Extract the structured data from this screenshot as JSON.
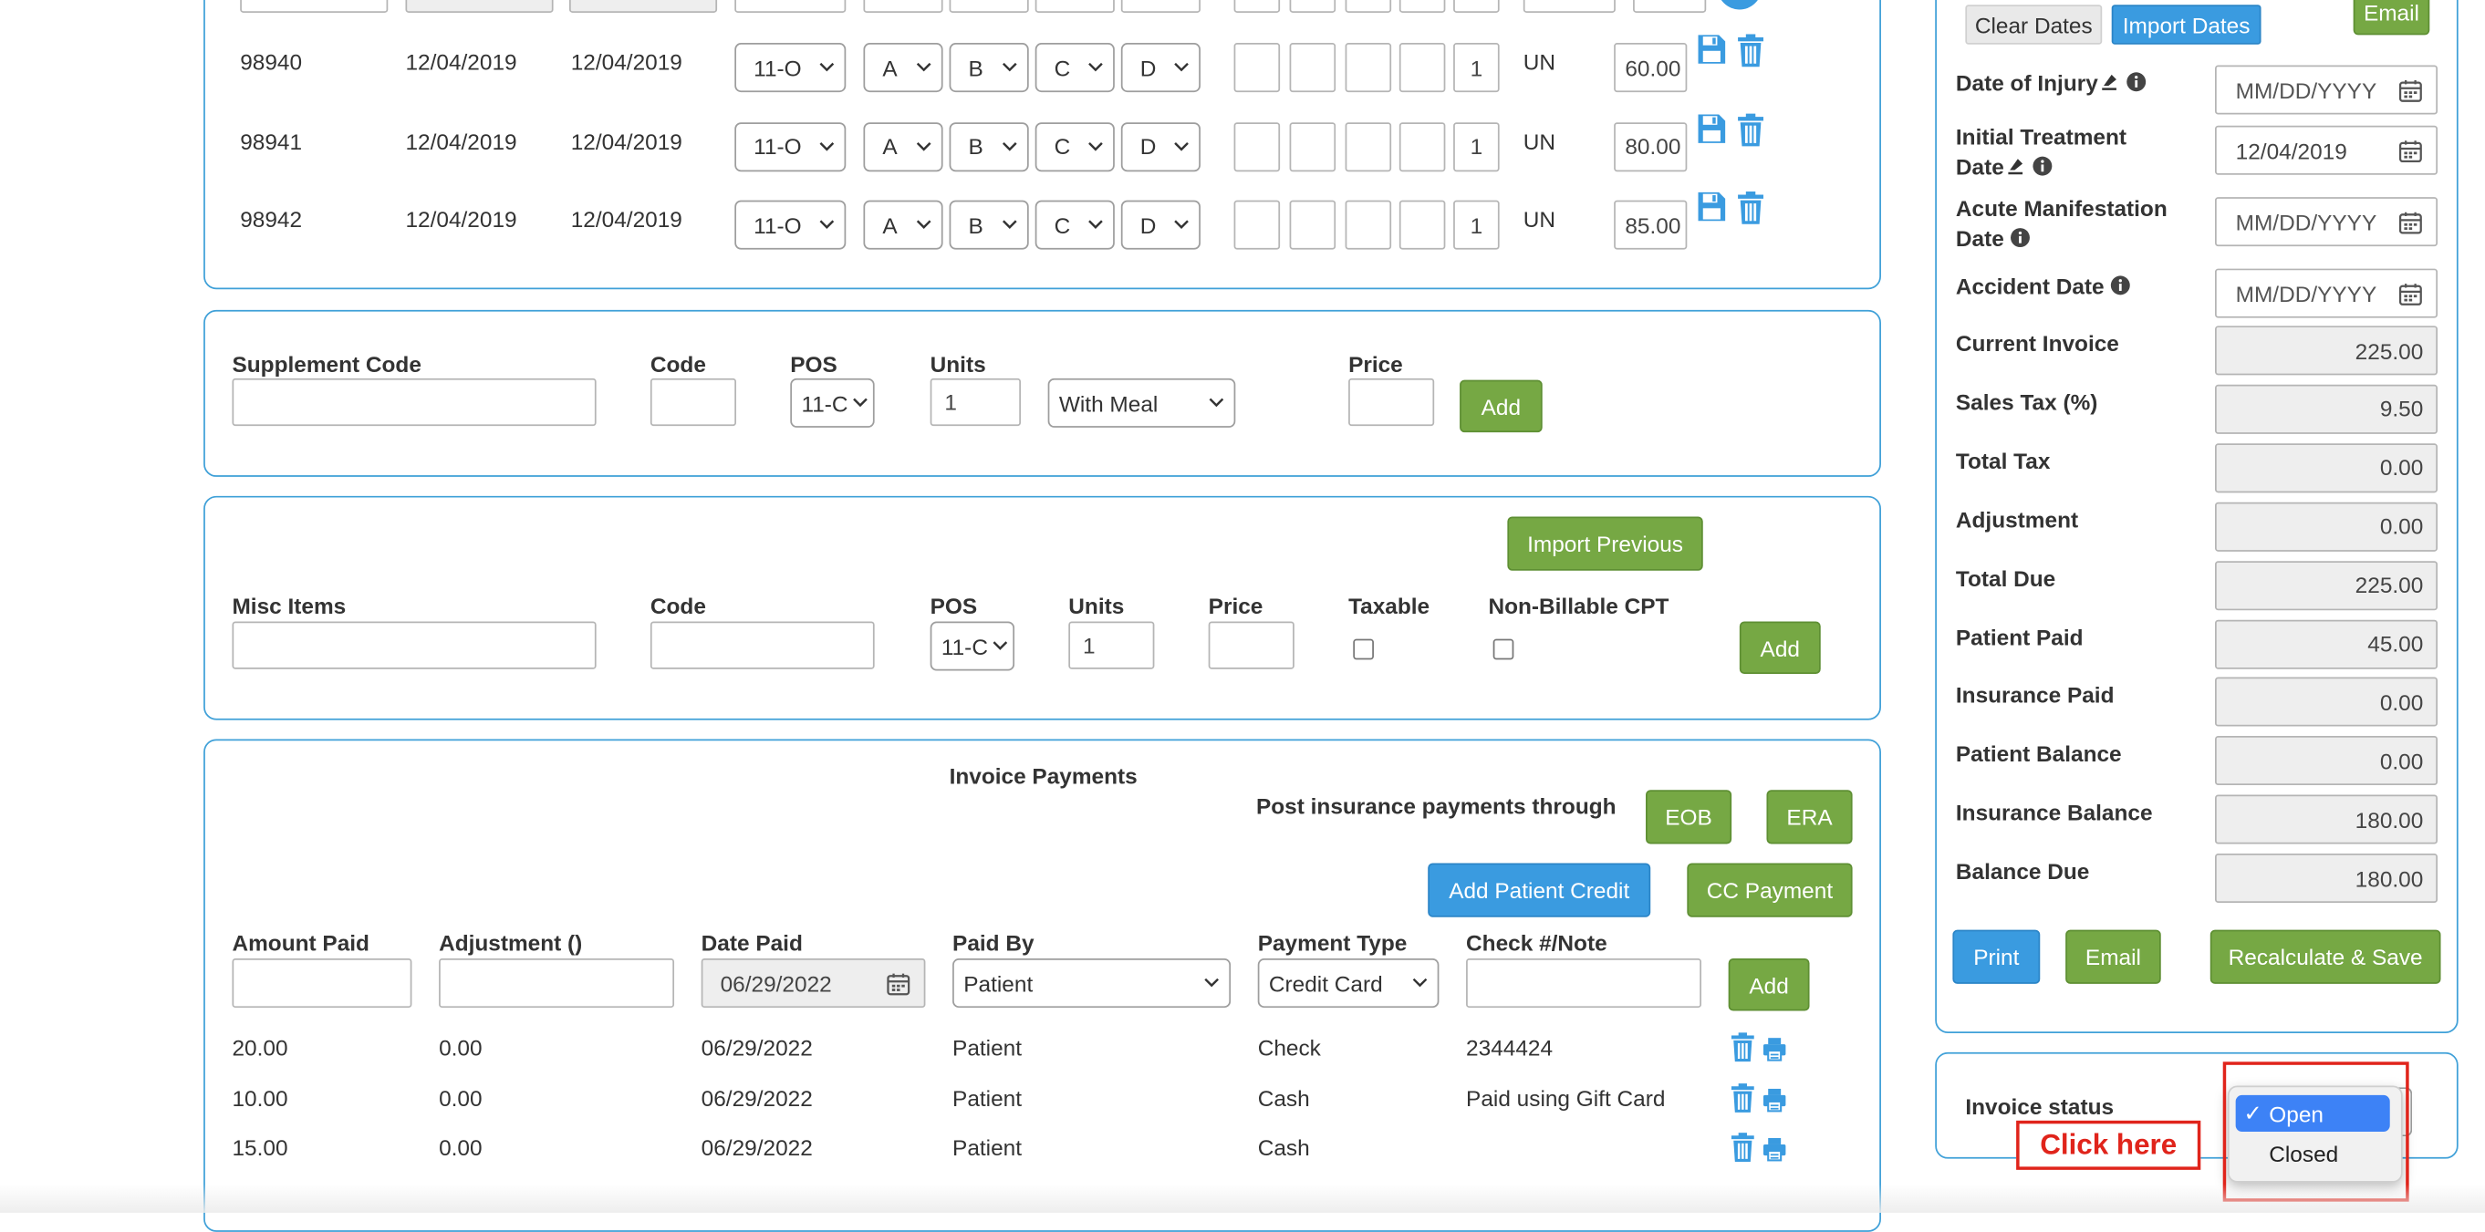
{
  "service_rows": [
    {
      "id": "98940",
      "from": "12/04/2019",
      "to": "12/04/2019",
      "pos": "11-O",
      "pointers": [
        "A",
        "B",
        "C",
        "D"
      ],
      "units": "1",
      "unit_type": "UN",
      "charge": "60.00"
    },
    {
      "id": "98941",
      "from": "12/04/2019",
      "to": "12/04/2019",
      "pos": "11-O",
      "pointers": [
        "A",
        "B",
        "C",
        "D"
      ],
      "units": "1",
      "unit_type": "UN",
      "charge": "80.00"
    },
    {
      "id": "98942",
      "from": "12/04/2019",
      "to": "12/04/2019",
      "pos": "11-O",
      "pointers": [
        "A",
        "B",
        "C",
        "D"
      ],
      "units": "1",
      "unit_type": "UN",
      "charge": "85.00"
    }
  ],
  "supplement": {
    "code_label": "Supplement Code",
    "code2_label": "Code",
    "pos_label": "POS",
    "units_label": "Units",
    "price_label": "Price",
    "pos_value": "11-C",
    "units_value": "1",
    "meal_value": "With Meal",
    "add": "Add"
  },
  "misc": {
    "import_previous": "Import Previous",
    "items_label": "Misc Items",
    "code_label": "Code",
    "pos_label": "POS",
    "units_label": "Units",
    "price_label": "Price",
    "taxable_label": "Taxable",
    "nonbillable_label": "Non-Billable CPT",
    "pos_value": "11-C",
    "units_value": "1",
    "add": "Add"
  },
  "payments": {
    "title": "Invoice Payments",
    "post_through": "Post insurance payments through",
    "eob": "EOB",
    "era": "ERA",
    "add_patient_credit": "Add Patient Credit",
    "cc_payment": "CC Payment",
    "headers": [
      "Amount Paid",
      "Adjustment ()",
      "Date Paid",
      "Paid By",
      "Payment Type",
      "Check #/Note"
    ],
    "date_value": "06/29/2022",
    "paid_by_value": "Patient",
    "type_value": "Credit Card",
    "add": "Add",
    "rows": [
      {
        "amount": "20.00",
        "adjustment": "0.00",
        "date": "06/29/2022",
        "by": "Patient",
        "type": "Check",
        "note": "2344424"
      },
      {
        "amount": "10.00",
        "adjustment": "0.00",
        "date": "06/29/2022",
        "by": "Patient",
        "type": "Cash",
        "note": "Paid using Gift Card"
      },
      {
        "amount": "15.00",
        "adjustment": "0.00",
        "date": "06/29/2022",
        "by": "Patient",
        "type": "Cash",
        "note": ""
      }
    ]
  },
  "sidebar": {
    "clear_dates": "Clear Dates",
    "import_dates": "Import Dates",
    "email_top": "Email",
    "dates": [
      {
        "label1": "Date of Injury",
        "label2": "",
        "value": "MM/DD/YYYY"
      },
      {
        "label1": "Initial Treatment",
        "label2": "Date",
        "value": "12/04/2019"
      },
      {
        "label1": "Acute Manifestation",
        "label2": "Date",
        "value": "MM/DD/YYYY"
      },
      {
        "label1": "Accident Date",
        "label2": "",
        "value": "MM/DD/YYYY"
      }
    ],
    "totals": [
      {
        "label": "Current Invoice",
        "value": "225.00"
      },
      {
        "label": "Sales Tax (%)",
        "value": "9.50"
      },
      {
        "label": "Total Tax",
        "value": "0.00"
      },
      {
        "label": "Adjustment",
        "value": "0.00"
      },
      {
        "label": "Total Due",
        "value": "225.00"
      },
      {
        "label": "Patient Paid",
        "value": "45.00"
      },
      {
        "label": "Insurance Paid",
        "value": "0.00"
      },
      {
        "label": "Patient Balance",
        "value": "0.00"
      },
      {
        "label": "Insurance Balance",
        "value": "180.00"
      },
      {
        "label": "Balance Due",
        "value": "180.00"
      }
    ],
    "print": "Print",
    "email": "Email",
    "recalculate": "Recalculate & Save"
  },
  "status": {
    "label": "Invoice status",
    "options": [
      "Open",
      "Closed"
    ],
    "selected": "Open",
    "check": "✓",
    "callout": "Click here"
  },
  "colors": {
    "accent_blue": "#3a9be0",
    "accent_green": "#76a844",
    "callout_red": "#e0241b",
    "panel_border": "#3fa0d8"
  }
}
